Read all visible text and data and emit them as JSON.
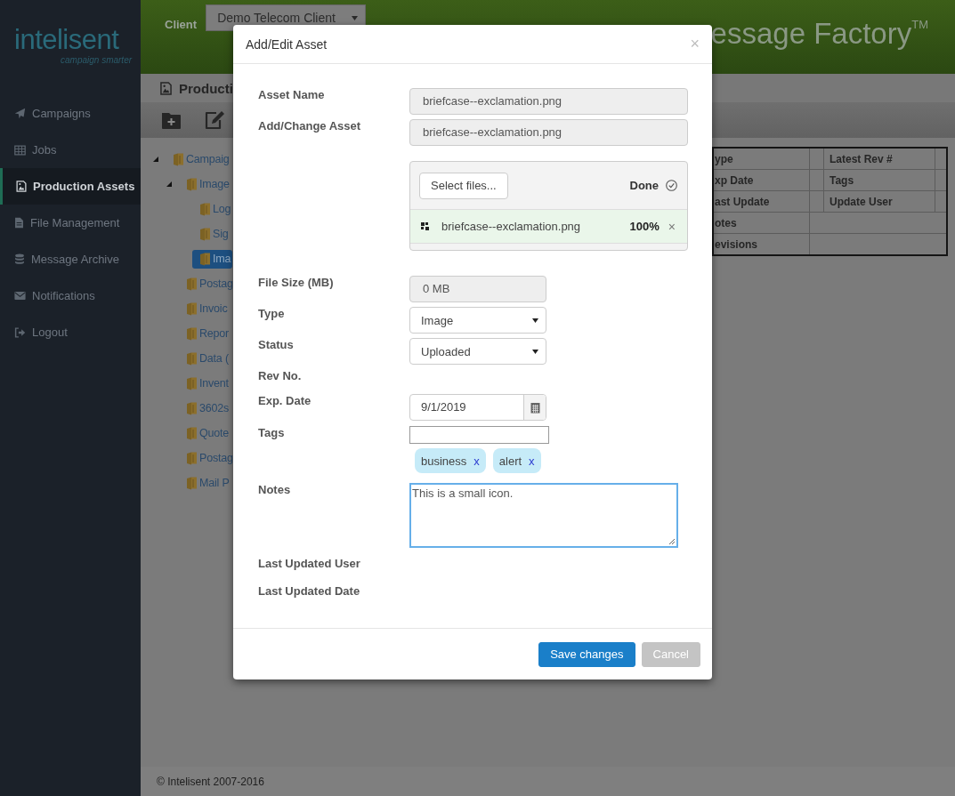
{
  "sidebar": {
    "logo": "intelisent",
    "tagline": "campaign smarter",
    "items": [
      {
        "label": "Campaigns",
        "selected": false
      },
      {
        "label": "Jobs",
        "selected": false
      },
      {
        "label": "Production Assets",
        "selected": true
      },
      {
        "label": "File Management",
        "selected": false
      },
      {
        "label": "Message Archive",
        "selected": false
      },
      {
        "label": "Notifications",
        "selected": false
      },
      {
        "label": "Logout",
        "selected": false
      }
    ]
  },
  "header": {
    "client_label": "Client",
    "client_select": "Demo Telecom Client",
    "app_title": "essage Factory",
    "trademark": "TM"
  },
  "page": {
    "title": "Producti",
    "tree": [
      {
        "label": "Campaig",
        "expanded": true,
        "selected": false,
        "children": [
          {
            "label": "Image",
            "expanded": true,
            "selected": false,
            "children": [
              {
                "label": "Log",
                "selected": false
              },
              {
                "label": "Sig",
                "selected": false
              },
              {
                "label": "Ima",
                "selected": true
              }
            ]
          },
          {
            "label": "Postag",
            "selected": false
          },
          {
            "label": "Invoic",
            "selected": false
          },
          {
            "label": "Repor",
            "selected": false
          },
          {
            "label": "Data (",
            "selected": false
          },
          {
            "label": "Invent",
            "selected": false
          },
          {
            "label": "3602s",
            "selected": false
          },
          {
            "label": "Quote",
            "selected": false
          },
          {
            "label": "Postag",
            "selected": false
          },
          {
            "label": "Mail P",
            "selected": false
          }
        ]
      }
    ],
    "details_table": {
      "rows": [
        [
          "ype",
          "Latest Rev #"
        ],
        [
          "xp Date",
          "Tags"
        ],
        [
          "ast Update",
          "Update User"
        ],
        [
          "otes"
        ],
        [
          "evisions"
        ]
      ]
    }
  },
  "footer": "© Intelisent 2007-2016",
  "modal": {
    "title": "Add/Edit Asset",
    "close": "×",
    "fields": [
      {
        "kind": "readonly",
        "label": "Asset Name",
        "value": "briefcase--exclamation.png"
      },
      {
        "kind": "readonly",
        "label": "Add/Change Asset",
        "value": "briefcase--exclamation.png"
      },
      {
        "kind": "upload",
        "select_button": "Select files...",
        "status": "Done",
        "files": [
          {
            "name": "briefcase--exclamation.png",
            "percent": "100%",
            "remove": "×"
          }
        ]
      },
      {
        "kind": "readonly-short",
        "label": "File Size (MB)",
        "value": "0 MB"
      },
      {
        "kind": "select",
        "label": "Type",
        "value": "Image"
      },
      {
        "kind": "select",
        "label": "Status",
        "value": "Uploaded"
      },
      {
        "kind": "none",
        "label": "Rev No."
      },
      {
        "kind": "date",
        "label": "Exp. Date",
        "value": "9/1/2019"
      },
      {
        "kind": "tags",
        "label": "Tags",
        "tags": [
          {
            "label": "business",
            "remove": "x"
          },
          {
            "label": "alert",
            "remove": "x"
          }
        ]
      },
      {
        "kind": "textarea",
        "label": "Notes",
        "value": "This is a small icon.",
        "focused": true
      },
      {
        "kind": "none",
        "label": "Last Updated User"
      },
      {
        "kind": "none",
        "label": "Last Updated Date"
      }
    ],
    "buttons": [
      {
        "label": "Save changes",
        "kind": "primary",
        "disabled": false
      },
      {
        "label": "Cancel",
        "kind": "secondary",
        "disabled": true
      }
    ]
  }
}
